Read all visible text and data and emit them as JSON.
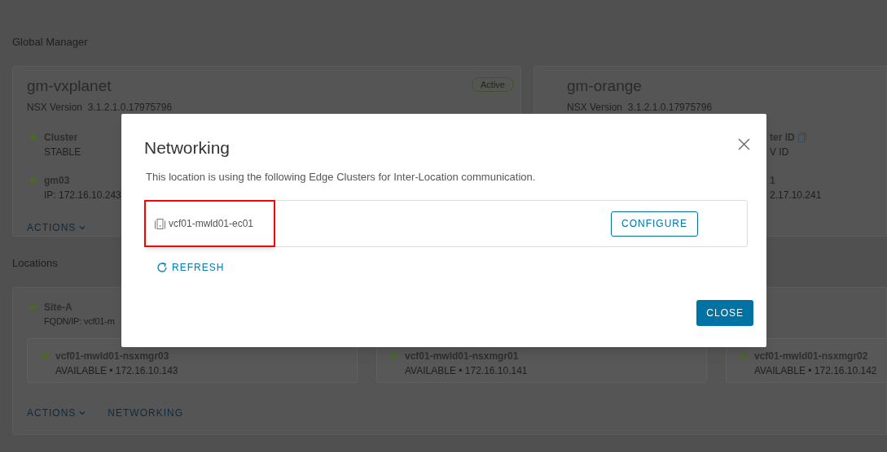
{
  "global_manager": {
    "heading": "Global Manager",
    "managers": [
      {
        "name": "gm-vxplanet",
        "badge": "Active",
        "version": "NSX Version  3.1.2.1.0.17975796",
        "stats": [
          {
            "label": "Cluster",
            "value": "STABLE",
            "copyable": false
          },
          {
            "label": "gm03",
            "value": "IP: 172.16.10.243",
            "copyable": false
          }
        ],
        "actions": "ACTIONS"
      },
      {
        "name": "gm-orange",
        "version": "NSX Version  3.1.2.1.0.17975796",
        "stats": [
          {
            "label": "ter ID",
            "value": "V ID",
            "copyable": true
          },
          {
            "label": "1",
            "value": "2.17.10.241",
            "copyable": false
          }
        ]
      }
    ]
  },
  "locations": {
    "heading": "Locations",
    "sites": [
      {
        "name": "Site-A",
        "fqdn": "FQDN/IP: vcf01-m",
        "managers": [
          {
            "name": "vcf01-mwld01-nsxmgr03",
            "detail": "AVAILABLE • 172.16.10.143"
          },
          {
            "name": "vcf01-mwld01-nsxmgr01",
            "detail": "AVAILABLE • 172.16.10.141"
          },
          {
            "name": "vcf01-mwld01-nsxmgr02",
            "detail": "AVAILABLE • 172.16.10.142"
          }
        ],
        "links": [
          {
            "label": "ACTIONS",
            "kind": "dropdown"
          },
          {
            "label": "NETWORKING",
            "kind": "link"
          }
        ]
      }
    ]
  },
  "modal": {
    "title": "Networking",
    "description": "This location is using the following Edge Clusters for Inter-Location communication.",
    "edge_clusters": [
      {
        "name": "vcf01-mwld01-ec01",
        "highlighted": true,
        "action": "CONFIGURE"
      }
    ],
    "refresh": "REFRESH",
    "close": "CLOSE"
  }
}
